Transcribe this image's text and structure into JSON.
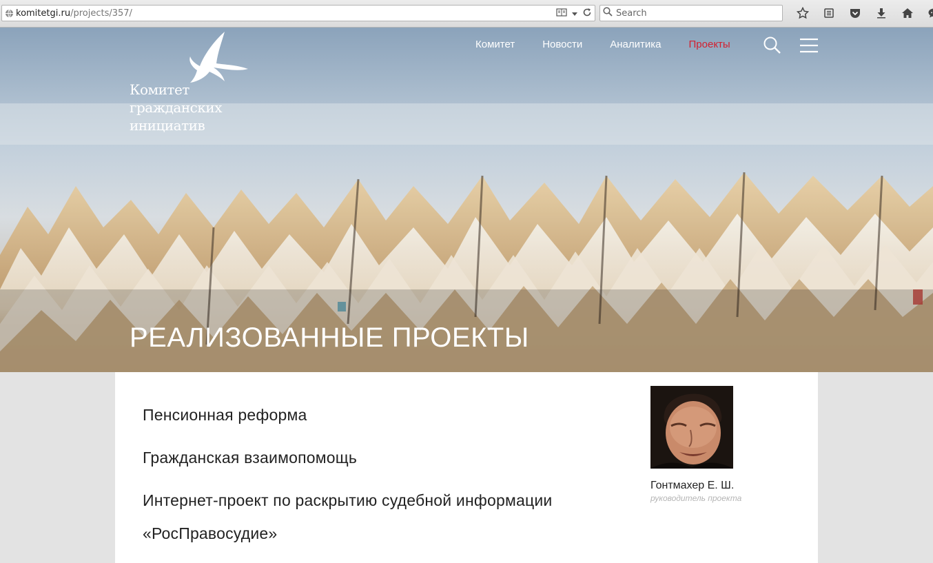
{
  "browser": {
    "url_domain": "komitetgi.ru",
    "url_path": "/projects/357/",
    "search_placeholder": "Search"
  },
  "site": {
    "logo_lines": [
      "Комитет",
      "гражданских",
      "инициатив"
    ],
    "nav": [
      {
        "label": "Комитет",
        "active": false
      },
      {
        "label": "Новости",
        "active": false
      },
      {
        "label": "Аналитика",
        "active": false
      },
      {
        "label": "Проекты",
        "active": true
      }
    ],
    "hero_title": "РЕАЛИЗОВАННЫЕ ПРОЕКТЫ",
    "active_nav_color": "#d3202f"
  },
  "projects": [
    "Пенсионная реформа",
    "Гражданская взаимопомощь",
    "Интернет-проект по раскрытию судебной информации «РосПравосудие»"
  ],
  "person": {
    "name": "Гонтмахер Е. Ш.",
    "role": "руководитель проекта"
  }
}
